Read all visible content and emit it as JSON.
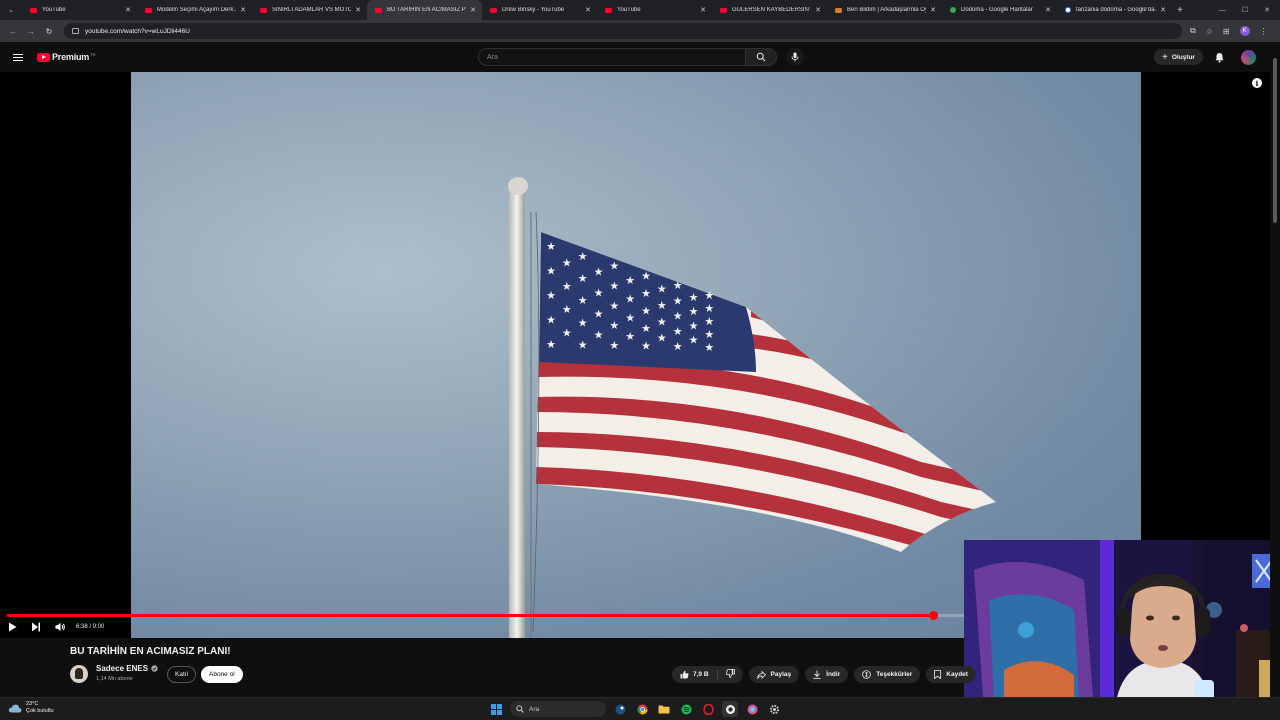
{
  "browser": {
    "tabs": [
      {
        "title": "YouTube",
        "favicon": "youtube-icon",
        "active": false
      },
      {
        "title": "Modelin Seçimi Açayım Derk...",
        "favicon": "youtube-icon",
        "active": false
      },
      {
        "title": "SINIRLI ADAMLAR VS MOTOR",
        "favicon": "youtube-icon",
        "active": false
      },
      {
        "title": "BU TARİHİN EN ACIMASIZ PL...",
        "favicon": "youtube-icon",
        "active": true
      },
      {
        "title": "Drew Binsky - YouTube",
        "favicon": "youtube-icon",
        "active": false
      },
      {
        "title": "YouTube",
        "favicon": "youtube-icon",
        "active": false
      },
      {
        "title": "GÜLERSEN KAYBEDERSİN w/ f...",
        "favicon": "youtube-icon",
        "active": false
      },
      {
        "title": "Ben Bildim | Arkadaşlarınla Oy...",
        "favicon": "extension-icon",
        "active": false
      },
      {
        "title": "Dodoma - Google Haritalar",
        "favicon": "maps-icon",
        "active": false
      },
      {
        "title": "tanzania dodoma - Google'da...",
        "favicon": "google-icon",
        "active": false
      }
    ],
    "url": "youtube.com/watch?v=wLuJDli446U",
    "profile_initial": "K"
  },
  "youtube": {
    "logo_text": "Premium",
    "region_code": "TR",
    "search_placeholder": "Ara",
    "create_label": "Oluştur"
  },
  "player": {
    "time_current": "6:38",
    "time_total": "9:00",
    "time_display": "6:38 / 9:00",
    "progress_fraction": 0.737
  },
  "video": {
    "title": "BU TARİHİN EN ACIMASIZ PLANI!",
    "channel_name": "Sadece ENES",
    "subscribers": "1,14 Mn abone",
    "join_label": "Katıl",
    "subscribe_label": "Abone ol",
    "likes": "7,9 B",
    "share_label": "Paylaş",
    "download_label": "İndir",
    "thanks_label": "Teşekkürler",
    "save_label": "Kaydet"
  },
  "taskbar": {
    "temperature": "23°C",
    "weather_text": "Çok bulutlu",
    "search_label": "Ara"
  },
  "colors": {
    "accent_red": "#ff0000",
    "background": "#0f0f0f"
  }
}
